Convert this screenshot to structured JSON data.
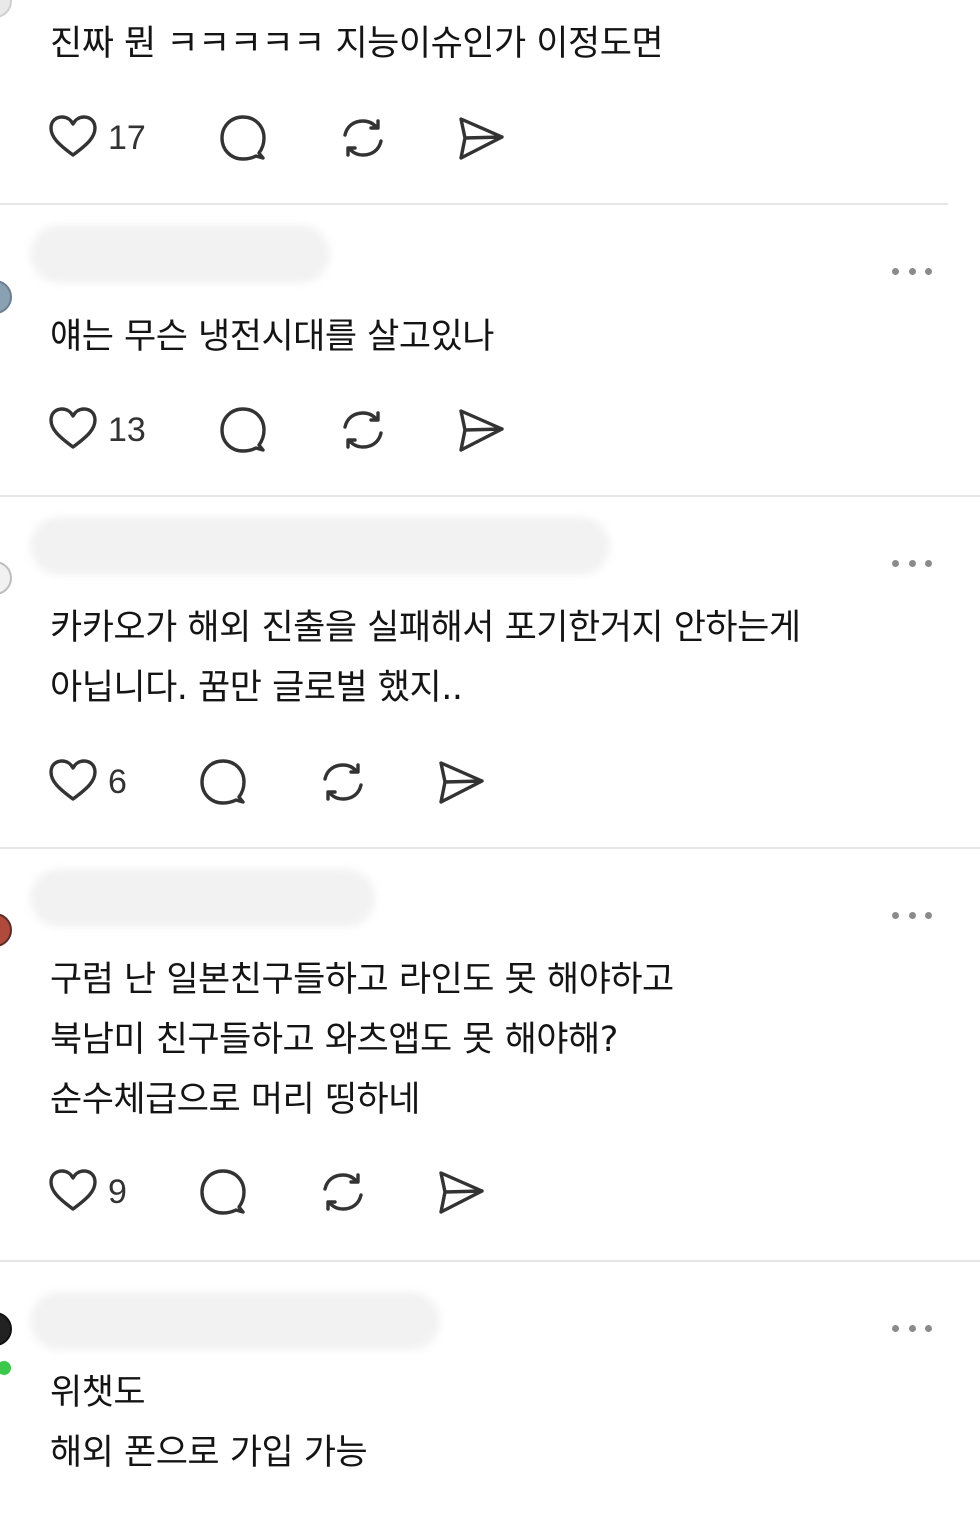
{
  "comments": [
    {
      "lines": [
        "진짜 뭔 ㅋㅋㅋㅋㅋ 지능이슈인가 이정도면"
      ],
      "likes": "17"
    },
    {
      "lines": [
        "얘는 무슨 냉전시대를 살고있나"
      ],
      "likes": "13"
    },
    {
      "lines": [
        "카카오가 해외 진출을 실패해서 포기한거지 안하는게",
        "아닙니다. 꿈만 글로벌 했지.."
      ],
      "likes": "6"
    },
    {
      "lines": [
        "구럼 난 일본친구들하고 라인도 못 해야하고",
        "북남미 친구들하고 와츠앱도 못 해야해?",
        "순수체급으로 머리 띵하네"
      ],
      "likes": "9"
    },
    {
      "lines": [
        "위챗도",
        "해외 폰으로 가입 가능"
      ]
    }
  ],
  "icons": {
    "like": "heart-icon",
    "reply": "comment-bubble-icon",
    "repost": "repost-icon",
    "share": "send-icon",
    "more": "more-dots-icon"
  },
  "colors": {
    "text": "#141414",
    "icon": "#333333",
    "divider": "#e6e6e6",
    "online": "#3cc84a"
  }
}
